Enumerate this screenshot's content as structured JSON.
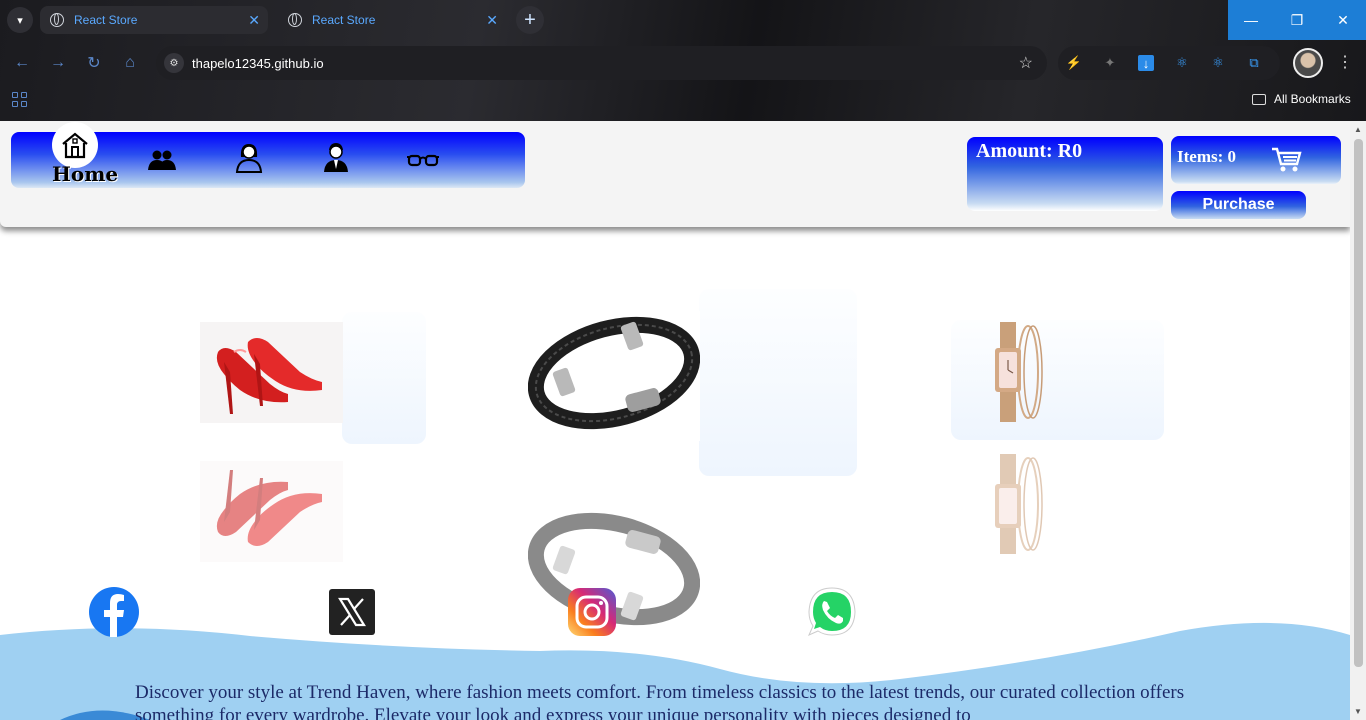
{
  "browser": {
    "tabs": [
      {
        "title": "React Store",
        "active": true
      },
      {
        "title": "React Store",
        "active": false
      }
    ],
    "url": "thapelo12345.github.io",
    "bookmarks_label": "All Bookmarks",
    "accent": "#1d7ed6"
  },
  "header": {
    "nav": [
      {
        "icon": "home-icon",
        "label": "Home",
        "active": true
      },
      {
        "icon": "group-icon"
      },
      {
        "icon": "woman-icon"
      },
      {
        "icon": "man-icon"
      },
      {
        "icon": "glasses-icon"
      }
    ],
    "amount_label": "Amount: R0",
    "items_label": "Items: 0",
    "purchase_label": "Purchase"
  },
  "products": [
    {
      "name": "red-heels",
      "icon": "heels-image"
    },
    {
      "name": "leather-bracelet",
      "icon": "bracelet-image"
    },
    {
      "name": "rose-gold-watch",
      "icon": "watch-image"
    }
  ],
  "social": [
    {
      "name": "facebook",
      "color": "#1877f2"
    },
    {
      "name": "x",
      "color": "#222222"
    },
    {
      "name": "instagram",
      "color": "#d62976"
    },
    {
      "name": "whatsapp",
      "color": "#25d366"
    }
  ],
  "footer": {
    "text": "Discover your style at Trend Haven, where fashion meets comfort. From timeless classics to the latest trends, our curated collection offers something for every wardrobe. Elevate your look and express your unique personality with pieces designed to"
  }
}
